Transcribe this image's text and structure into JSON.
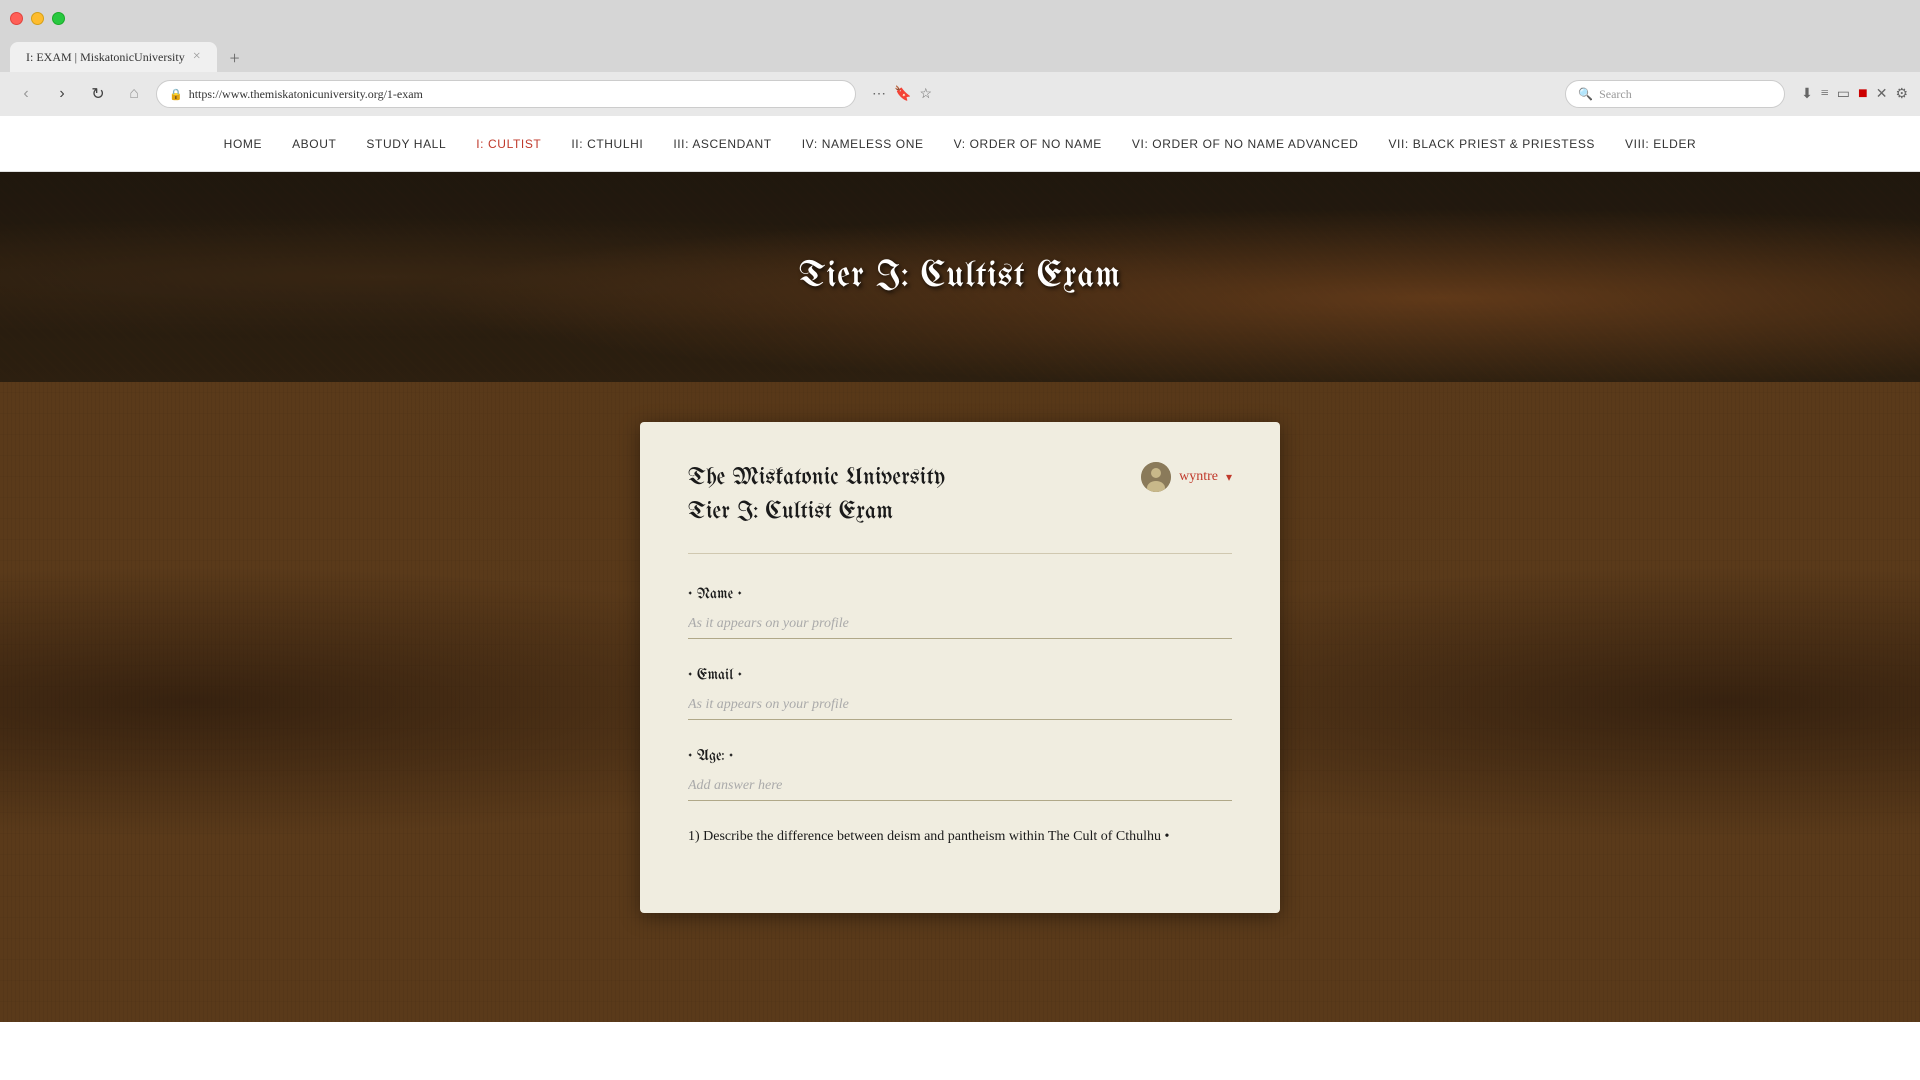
{
  "browser": {
    "tab_title": "I: EXAM | MiskatonicUniversity",
    "tab_close": "×",
    "new_tab": "+",
    "address": "https://www.themiskatonicuniversity.org/1-exam",
    "search_placeholder": "Search",
    "nav_back": "‹",
    "nav_forward": "›",
    "nav_refresh": "↻",
    "nav_home": "⌂",
    "security_icon": "🔒"
  },
  "site_nav": {
    "items": [
      {
        "label": "HOME",
        "active": false
      },
      {
        "label": "ABOUT",
        "active": false
      },
      {
        "label": "STUDY HALL",
        "active": false
      },
      {
        "label": "I: CULTIST",
        "active": true
      },
      {
        "label": "II: CTHULHI",
        "active": false
      },
      {
        "label": "III: ASCENDANT",
        "active": false
      },
      {
        "label": "IV: NAMELESS ONE",
        "active": false
      },
      {
        "label": "V: ORDER OF NO NAME",
        "active": false
      },
      {
        "label": "VI: ORDER OF NO NAME ADVANCED",
        "active": false
      },
      {
        "label": "VII: BLACK PRIEST & PRIESTESS",
        "active": false
      },
      {
        "label": "VIII: ELDER",
        "active": false
      }
    ]
  },
  "hero": {
    "title": "Tier I: Cultist Exam"
  },
  "form": {
    "title_line1": "The Miskatonic University",
    "title_line2": "Tier I: Cultist Exam",
    "user": {
      "name": "wyntre",
      "chevron": "▾"
    },
    "fields": [
      {
        "label": "• Name •",
        "placeholder": "As it appears on your profile",
        "type": "text"
      },
      {
        "label": "• Email •",
        "placeholder": "As it appears on your profile",
        "type": "email"
      },
      {
        "label": "• Age: •",
        "placeholder": "Add answer here",
        "type": "text"
      }
    ],
    "question": "1) Describe the difference between deism and pantheism within The Cult of Cthulhu •"
  }
}
